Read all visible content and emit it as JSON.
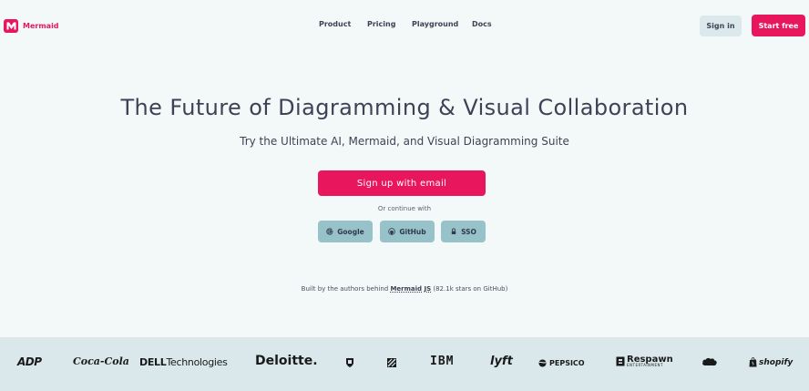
{
  "header": {
    "brand": "Mermaid",
    "nav": [
      "Product",
      "Pricing",
      "Playground",
      "Docs"
    ],
    "sign_in": "Sign in",
    "start_free": "Start free"
  },
  "hero": {
    "title": "The Future of Diagramming & Visual Collaboration",
    "subtitle": "Try the Ultimate AI, Mermaid, and Visual Diagramming Suite",
    "signup_email": "Sign up with email",
    "or_continue": "Or continue with",
    "social": {
      "google": "Google",
      "github": "GitHub",
      "sso": "SSO"
    },
    "built_by_prefix": "Built by the authors behind",
    "built_by_link": "Mermaid JS",
    "built_by_suffix": "(82.1k stars on GitHub)"
  },
  "logos": {
    "adp": "ADP",
    "cocacola": "Coca-Cola",
    "dell_bold": "DELL",
    "dell_rest": "Technologies",
    "deloitte": "Deloitte.",
    "ibm": "IBM",
    "lyft": "lyft",
    "pepsico": "PEPSICO",
    "respawn": "Respawn",
    "respawn_sub": "ENTERTAINMENT",
    "shopify": "shopify"
  },
  "colors": {
    "brand": "#e8175d",
    "background": "#f3f8f8",
    "social_button": "#98c2c9",
    "signin_button": "#dbe9ec",
    "logos_band": "#dae8ec"
  }
}
